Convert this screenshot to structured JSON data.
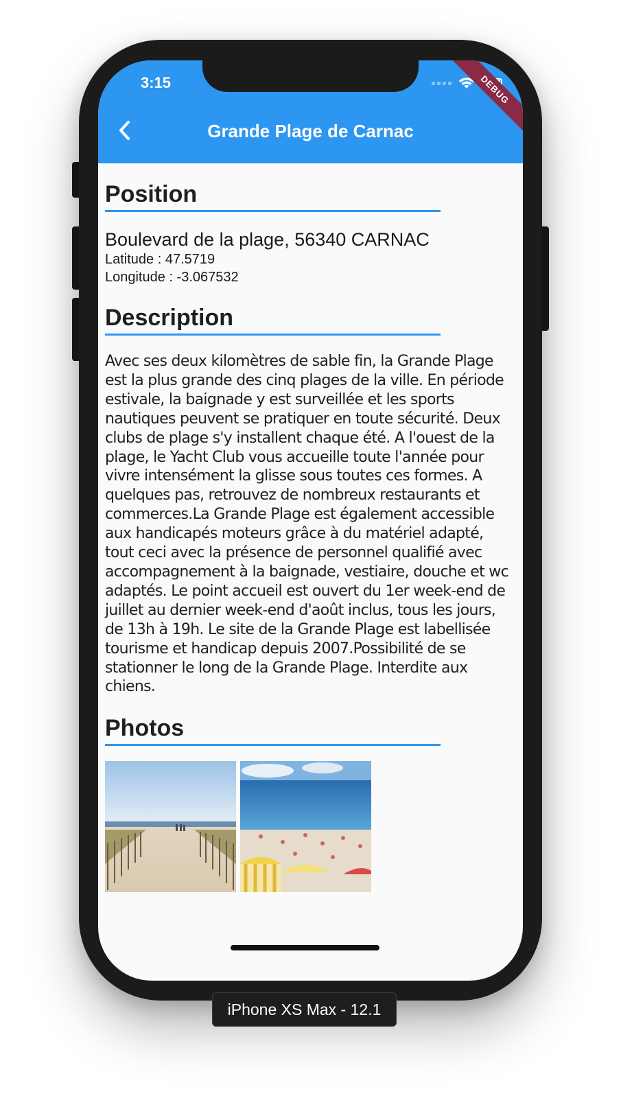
{
  "status_bar": {
    "time": "3:15",
    "debug_banner": "DEBUG"
  },
  "app_bar": {
    "title": "Grande Plage de Carnac",
    "back_icon": "chevron-left-icon",
    "background_color": "#2d96f0"
  },
  "sections": {
    "position": {
      "heading": "Position",
      "address": "Boulevard de la plage, 56340 CARNAC",
      "latitude": "Latitude : 47.5719",
      "longitude": "Longitude : -3.067532"
    },
    "description": {
      "heading": "Description",
      "text": "Avec ses deux kilomètres de sable fin, la Grande Plage est la plus grande des cinq plages de la ville. En période estivale, la baignade y est surveillée et les sports nautiques peuvent se pratiquer en toute sécurité. Deux clubs de plage s'y installent chaque été. A l'ouest de la plage, le Yacht Club vous accueille toute l'année pour vivre intensément la glisse sous toutes ces formes. A quelques pas, retrouvez de nombreux restaurants et commerces.La Grande Plage est également accessible aux handicapés moteurs grâce à du matériel adapté, tout ceci avec la présence de personnel qualifié avec accompagnement à la baignade, vestiaire, douche et wc adaptés. Le point accueil est ouvert du 1er week-end de juillet au dernier week-end d'août inclus, tous les jours, de 13h à 19h. Le site de la Grande Plage est labellisée tourisme et handicap depuis 2007.Possibilité de se stationner le long de la Grande Plage. Interdite aux chiens."
    },
    "photos": {
      "heading": "Photos",
      "items": [
        {
          "name": "beach-path-photo"
        },
        {
          "name": "crowded-beach-photo"
        }
      ]
    }
  },
  "device_label": "iPhone XS Max - 12.1",
  "accent_color": "#2d96f0"
}
